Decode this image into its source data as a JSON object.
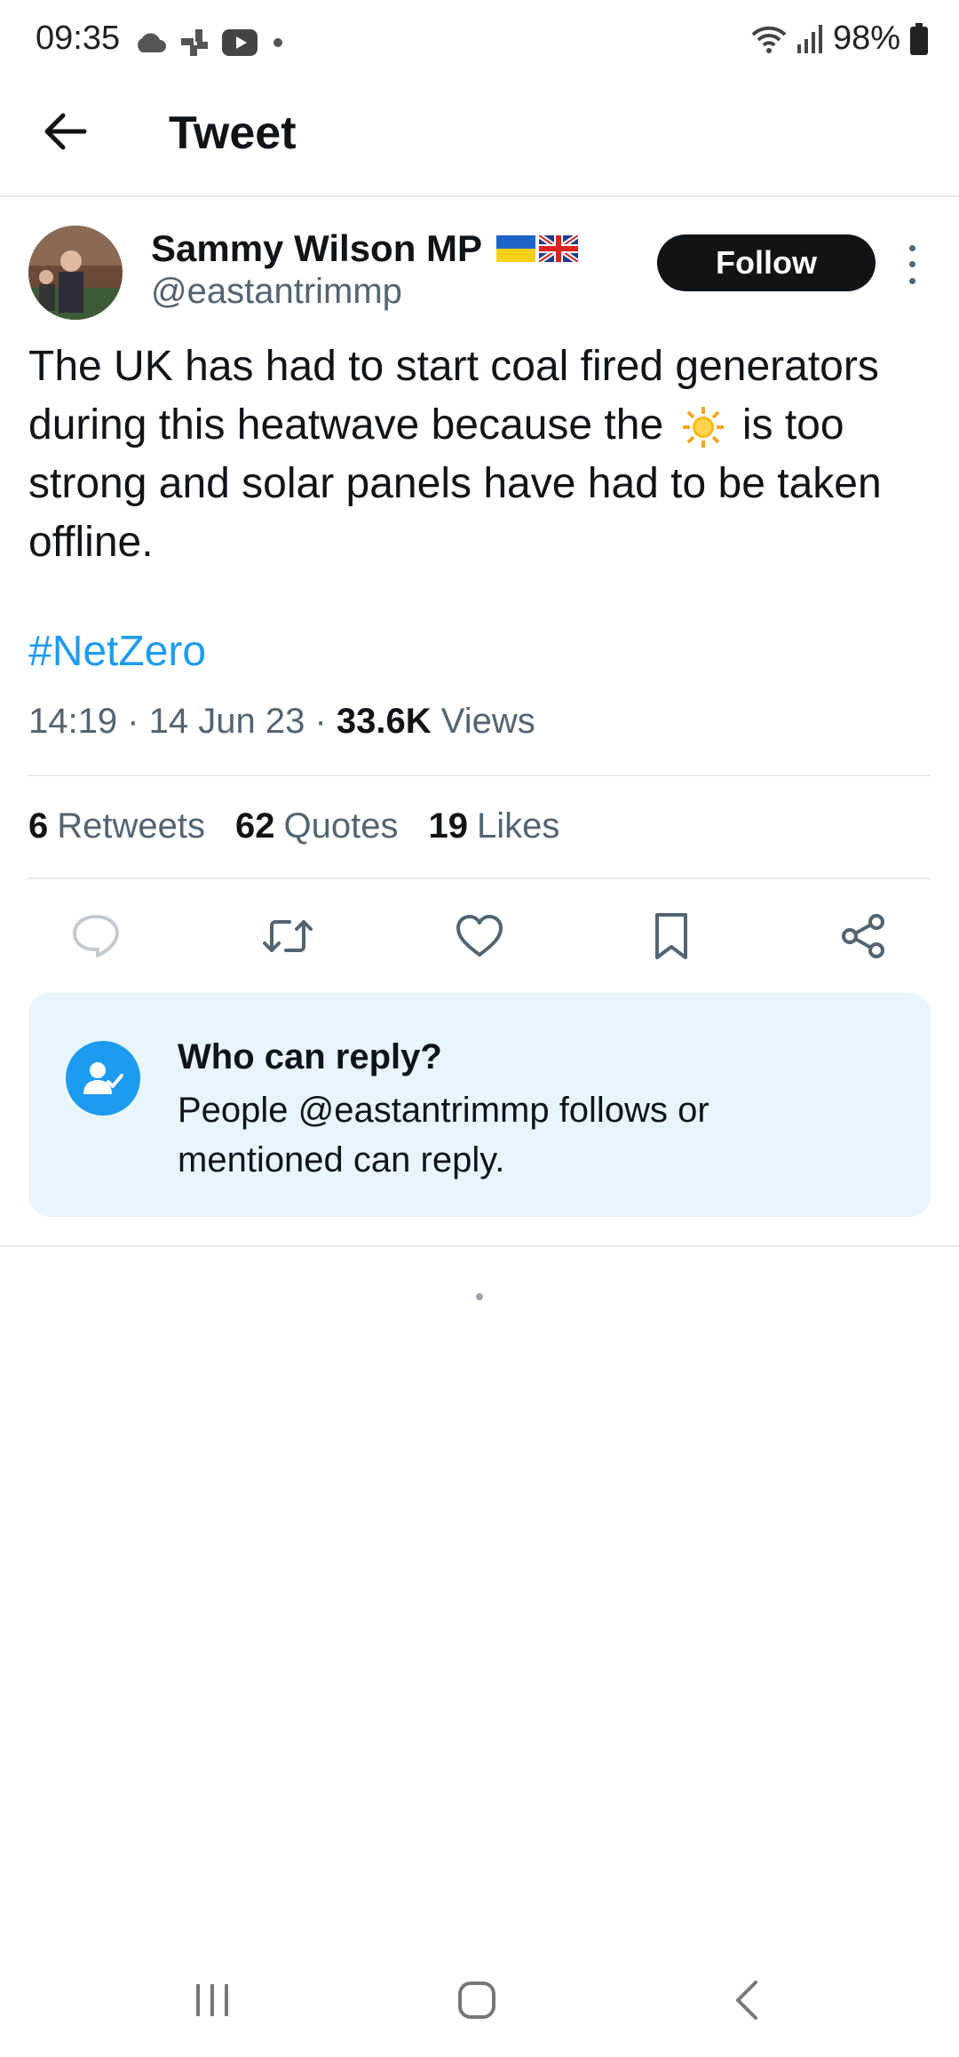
{
  "status_bar": {
    "time": "09:35",
    "battery": "98%"
  },
  "header": {
    "title": "Tweet"
  },
  "tweet": {
    "author_name": "Sammy Wilson MP",
    "handle": "@eastantrimmp",
    "follow_label": "Follow",
    "text_before_emoji": "The UK has had to start coal fired generators during this heatwave because the",
    "text_after_emoji": "is too strong and solar panels have had to be taken offline.",
    "hashtag": "#NetZero",
    "time": "14:19",
    "date": "14 Jun 23",
    "views_count": "33.6K",
    "views_label": "Views"
  },
  "stats": {
    "retweets_count": "6",
    "retweets_label": "Retweets",
    "quotes_count": "62",
    "quotes_label": "Quotes",
    "likes_count": "19",
    "likes_label": "Likes"
  },
  "reply_settings": {
    "title": "Who can reply?",
    "body": "People @eastantrimmp follows or mentioned can reply."
  },
  "icons": {
    "back": "arrow-left-icon",
    "more": "more-vertical-icon",
    "reply": "reply-icon",
    "retweet": "retweet-icon",
    "like": "heart-icon",
    "bookmark": "bookmark-icon",
    "share": "share-icon",
    "who_can_reply": "person-check-icon"
  },
  "colors": {
    "accent": "#1d9bf0",
    "text": "#0f1419",
    "secondary": "#536471",
    "reply_card_bg": "#e8f5fd"
  }
}
